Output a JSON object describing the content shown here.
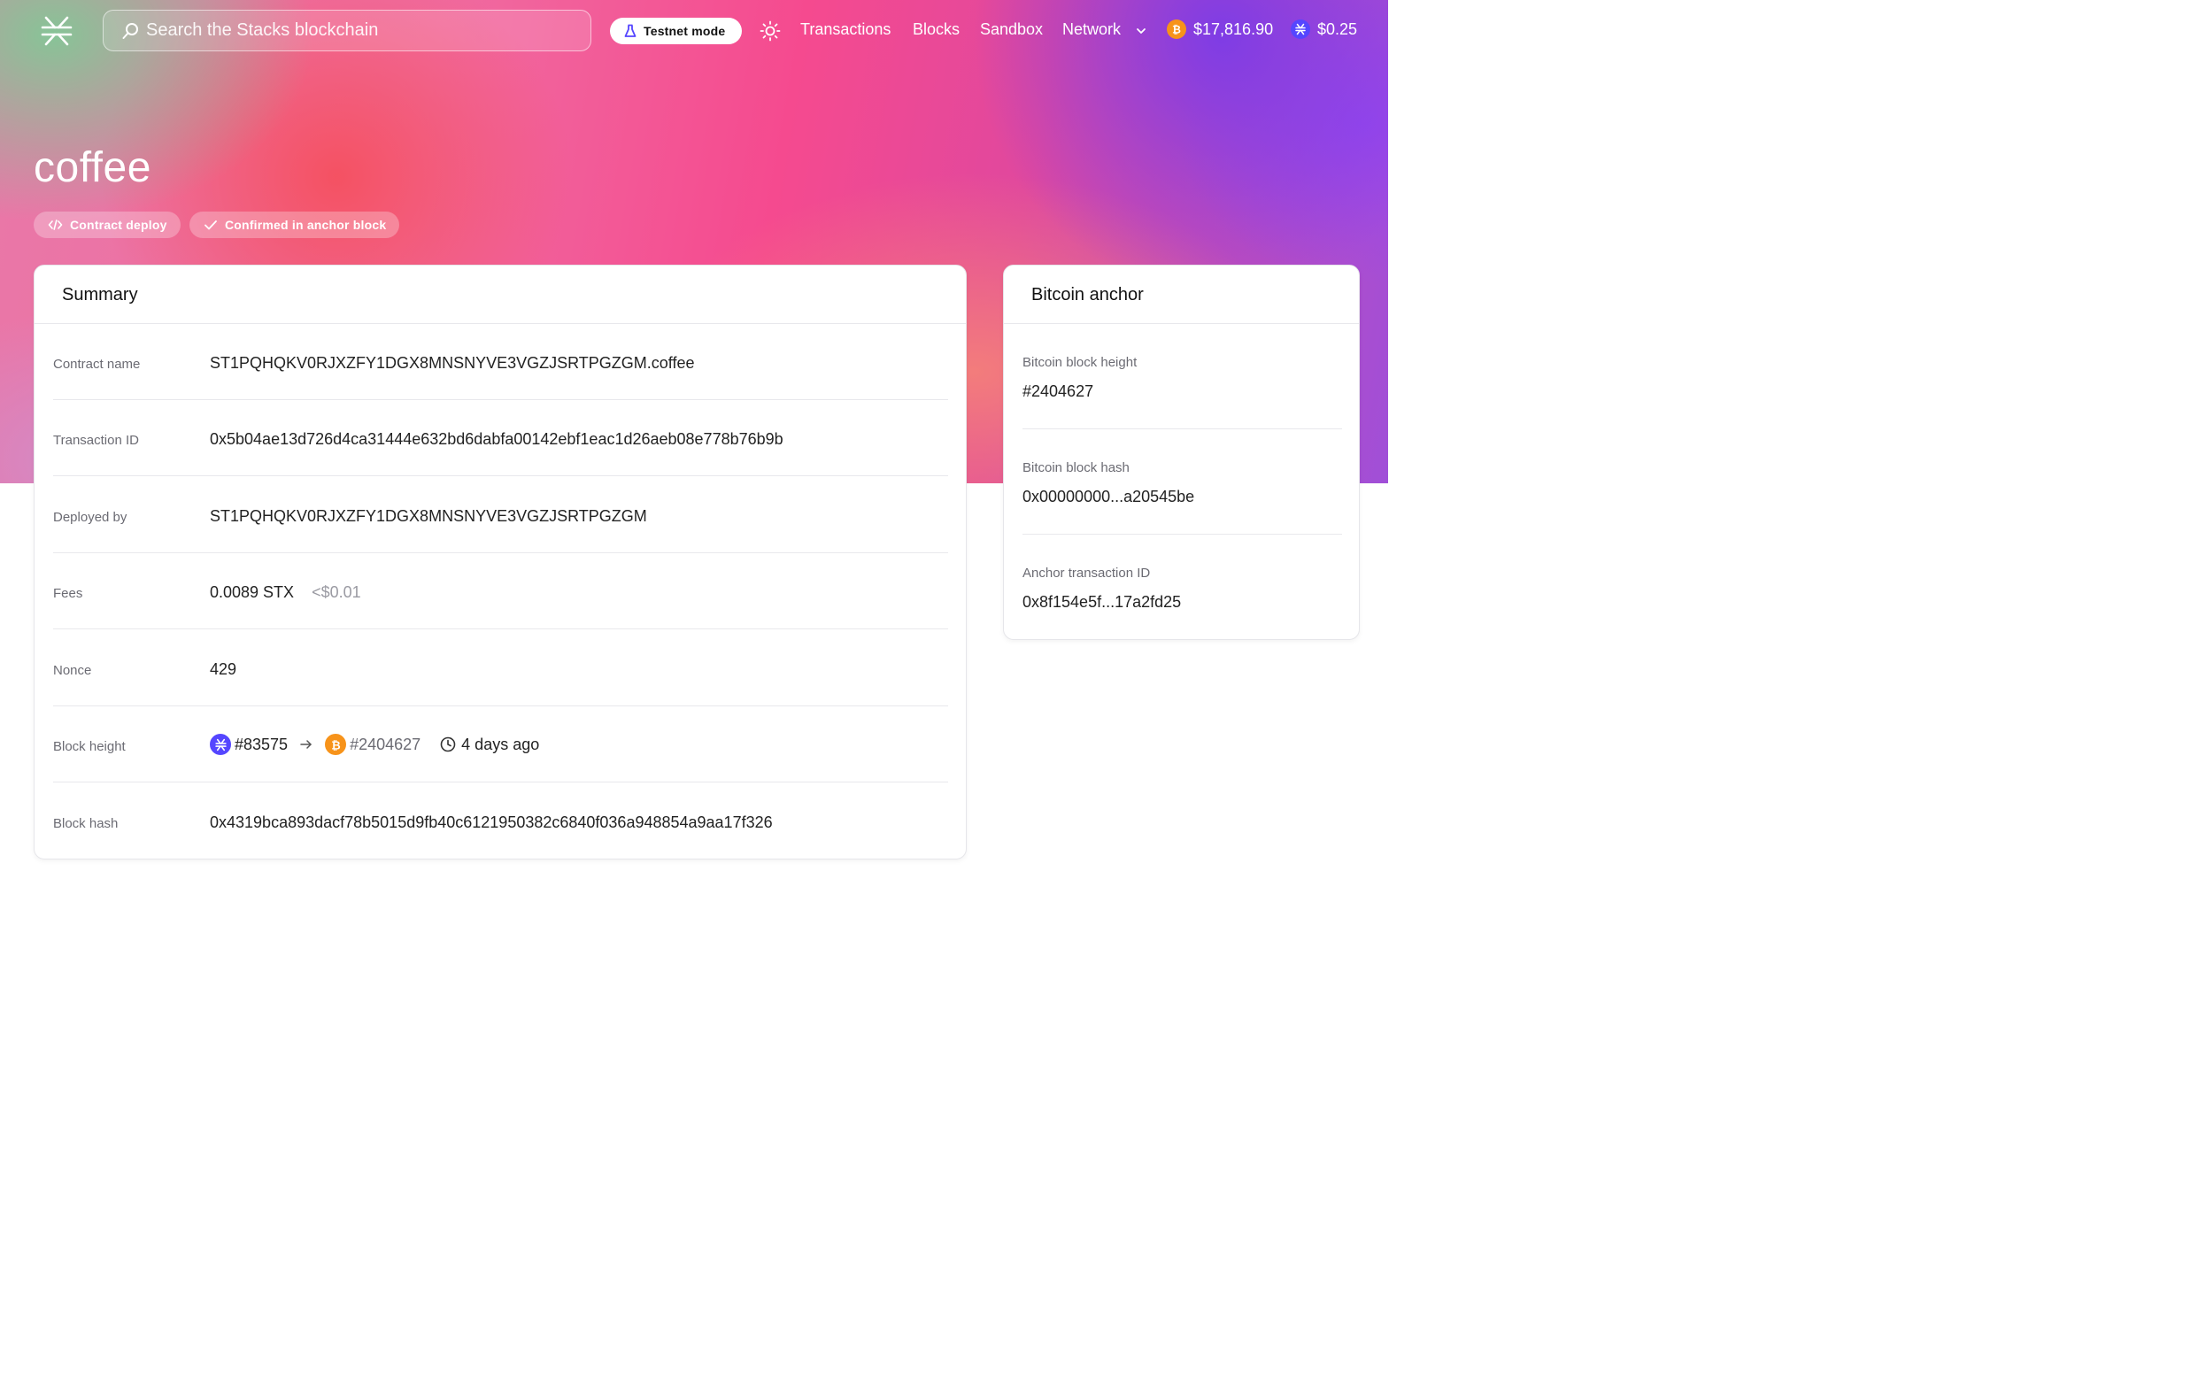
{
  "header": {
    "search_placeholder": "Search the Stacks blockchain",
    "testnet_label": "Testnet mode",
    "nav": [
      "Transactions",
      "Blocks",
      "Sandbox",
      "Network"
    ],
    "btc_price": "$17,816.90",
    "stx_price": "$0.25"
  },
  "page_title": "coffee",
  "tags": [
    "Contract deploy",
    "Confirmed in anchor block"
  ],
  "summary": {
    "title": "Summary",
    "contract_name_label": "Contract name",
    "contract_name": "ST1PQHQKV0RJXZFY1DGX8MNSNYVE3VGZJSRTPGZGM.coffee",
    "tx_id_label": "Transaction ID",
    "tx_id": "0x5b04ae13d726d4ca31444e632bd6dabfa00142ebf1eac1d26aeb08e778b76b9b",
    "deployed_by_label": "Deployed by",
    "deployed_by": "ST1PQHQKV0RJXZFY1DGX8MNSNYVE3VGZJSRTPGZGM",
    "fees_label": "Fees",
    "fees_stx": "0.0089 STX",
    "fees_usd": "<$0.01",
    "nonce_label": "Nonce",
    "nonce": "429",
    "block_height_label": "Block height",
    "stacks_block": "#83575",
    "btc_block": "#2404627",
    "time_ago": "4 days ago",
    "block_hash_label": "Block hash",
    "block_hash": "0x4319bca893dacf78b5015d9fb40c6121950382c6840f036a948854a9aa17f326"
  },
  "anchor": {
    "title": "Bitcoin anchor",
    "height_label": "Bitcoin block height",
    "height": "#2404627",
    "hash_label": "Bitcoin block hash",
    "hash": "0x00000000...a20545be",
    "anchor_tx_label": "Anchor transaction ID",
    "anchor_tx": "0x8f154e5f...17a2fd25"
  },
  "colors": {
    "btc": "#f7931a",
    "stx": "#5546ff"
  },
  "icons": [
    "stacks-logo-icon",
    "search-icon",
    "close-icon",
    "flask-icon",
    "sun-icon",
    "chevron-down-icon",
    "bitcoin-icon",
    "stacks-icon",
    "code-icon",
    "check-icon",
    "arrow-right-icon",
    "clock-icon"
  ]
}
